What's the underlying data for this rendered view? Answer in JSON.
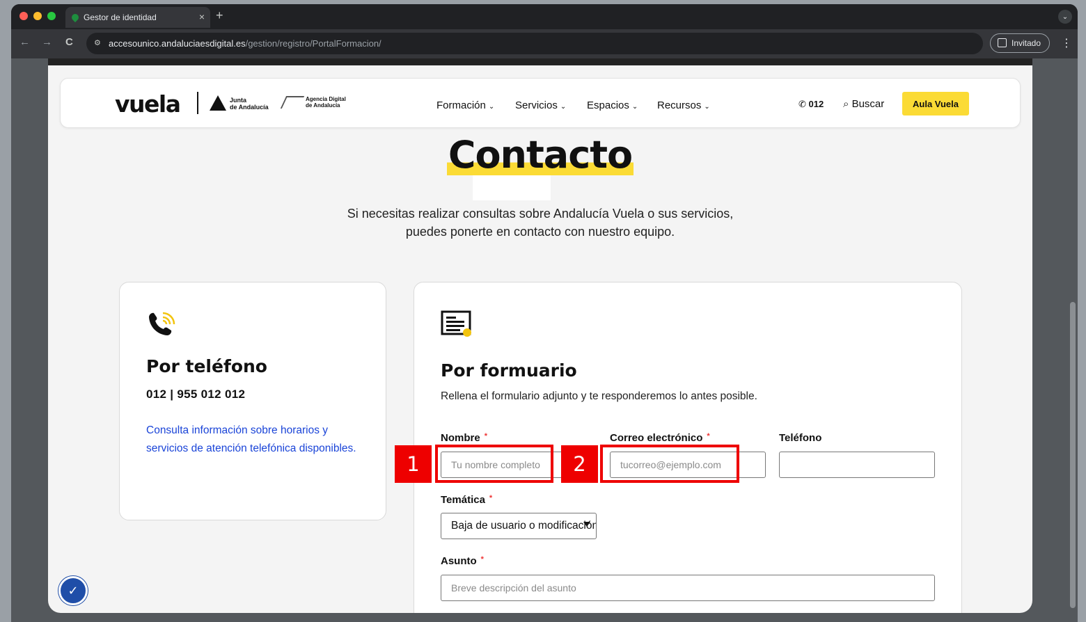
{
  "browser": {
    "tab_title": "Gestor de identidad",
    "tab_close": "×",
    "new_tab": "+",
    "tab_menu": "⌄",
    "url_host": "accesounico.andaluciaesdigital.es",
    "url_path": "/gestion/registro/PortalFormacion/",
    "profile_label": "Invitado",
    "nav_back": "←",
    "nav_forward": "→",
    "nav_reload": "C",
    "site_info": "⚙",
    "menu": "⋮"
  },
  "header": {
    "logo": "vuela",
    "junta_line1": "Junta",
    "junta_line2": "de Andalucía",
    "agencia_line1": "Agencia Digital",
    "agencia_line2": "de Andalucía",
    "nav": [
      {
        "label": "Formación"
      },
      {
        "label": "Servicios"
      },
      {
        "label": "Espacios"
      },
      {
        "label": "Recursos"
      }
    ],
    "phone": "012",
    "search": "Buscar",
    "cta": "Aula Vuela"
  },
  "main": {
    "title": "Contacto",
    "intro_line1": "Si necesitas realizar consultas sobre Andalucía Vuela o sus servicios,",
    "intro_line2": "puedes ponerte en contacto con nuestro equipo."
  },
  "phone_card": {
    "heading": "Por teléfono",
    "numbers": "012 | 955 012 012",
    "link": "Consulta información sobre horarios y servicios de atención telefónica disponibles."
  },
  "form_card": {
    "heading": "Por formuario",
    "description": "Rellena el formulario adjunto y te responderemos lo antes posible.",
    "required_mark": "*",
    "name_label": "Nombre",
    "name_placeholder": "Tu nombre completo",
    "email_label": "Correo electrónico",
    "email_placeholder": "tucorreo@ejemplo.com",
    "phone_label": "Teléfono",
    "topic_label": "Temática",
    "topic_selected": "Baja de usuario o modificación",
    "subject_label": "Asunto",
    "subject_placeholder": "Breve descripción del asunto"
  },
  "annotations": [
    {
      "label": "1"
    },
    {
      "label": "2"
    }
  ],
  "colors": {
    "accent_yellow": "#fbdb35",
    "link_blue": "#1a44d8",
    "annotation_red": "#e00000"
  }
}
